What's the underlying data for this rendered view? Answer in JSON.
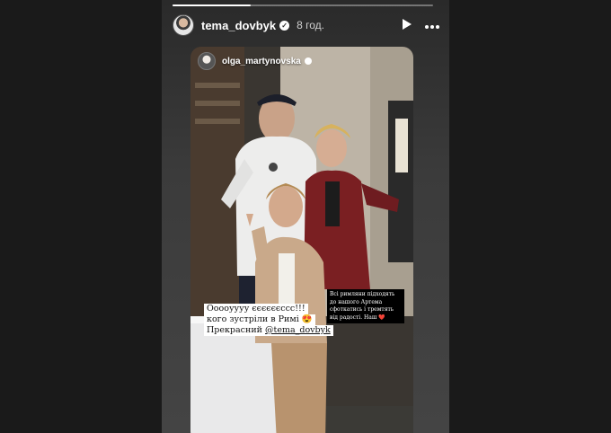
{
  "story": {
    "username": "tema_dovbyk",
    "time": "8 год.",
    "progress": 0.3,
    "play_icon": "play-icon",
    "more_icon": "more-horizontal-icon",
    "verified_icon": "verified-badge-icon"
  },
  "reshare": {
    "username": "olga_martynovska",
    "small_caption": "Всі римляни підходять до нашого Артема сфоткатись і тремтять від радості. Наш ❤️",
    "main_caption": {
      "line1": "Ооооуууу єєєєєєссс!!!",
      "line2": "кого зустріли в Римі 😍",
      "line3_prefix": "Прекрасний ",
      "mention": "@tema_dovbyk"
    }
  }
}
